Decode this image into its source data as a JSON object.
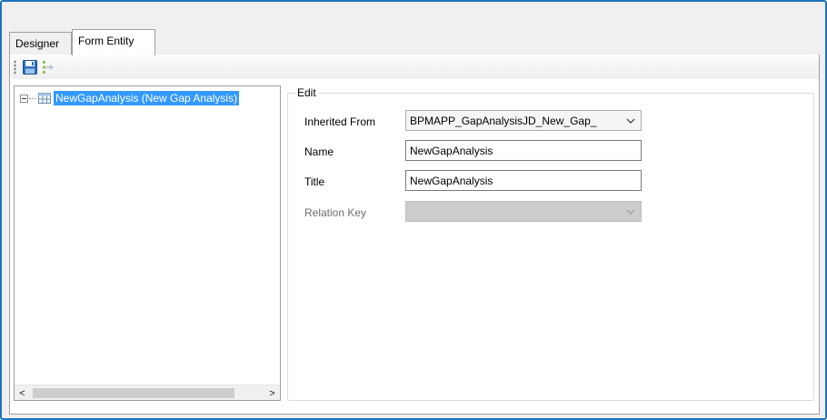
{
  "tabs": [
    {
      "label": "Designer",
      "active": false
    },
    {
      "label": "Form Entity",
      "active": true
    }
  ],
  "toolbar": {
    "buttons": [
      {
        "icon": "save-icon"
      },
      {
        "icon": "tree-export-icon"
      }
    ]
  },
  "tree": {
    "items": [
      {
        "label": "NewGapAnalysis (New Gap Analysis)",
        "selected": true,
        "icon": "table-icon",
        "expanded": true
      }
    ],
    "scroll_left": "<",
    "scroll_right": ">"
  },
  "edit": {
    "title": "Edit",
    "inherited_from": {
      "label": "Inherited From",
      "value": "BPMAPP_GapAnalysisJD_New_Gap_"
    },
    "name": {
      "label": "Name",
      "value": "NewGapAnalysis"
    },
    "title_field": {
      "label": "Title",
      "value": "NewGapAnalysis"
    },
    "relation_key": {
      "label": "Relation Key",
      "value": "",
      "disabled": true
    }
  },
  "colors": {
    "frame_border": "#1e73be",
    "selection": "#3399ff"
  }
}
